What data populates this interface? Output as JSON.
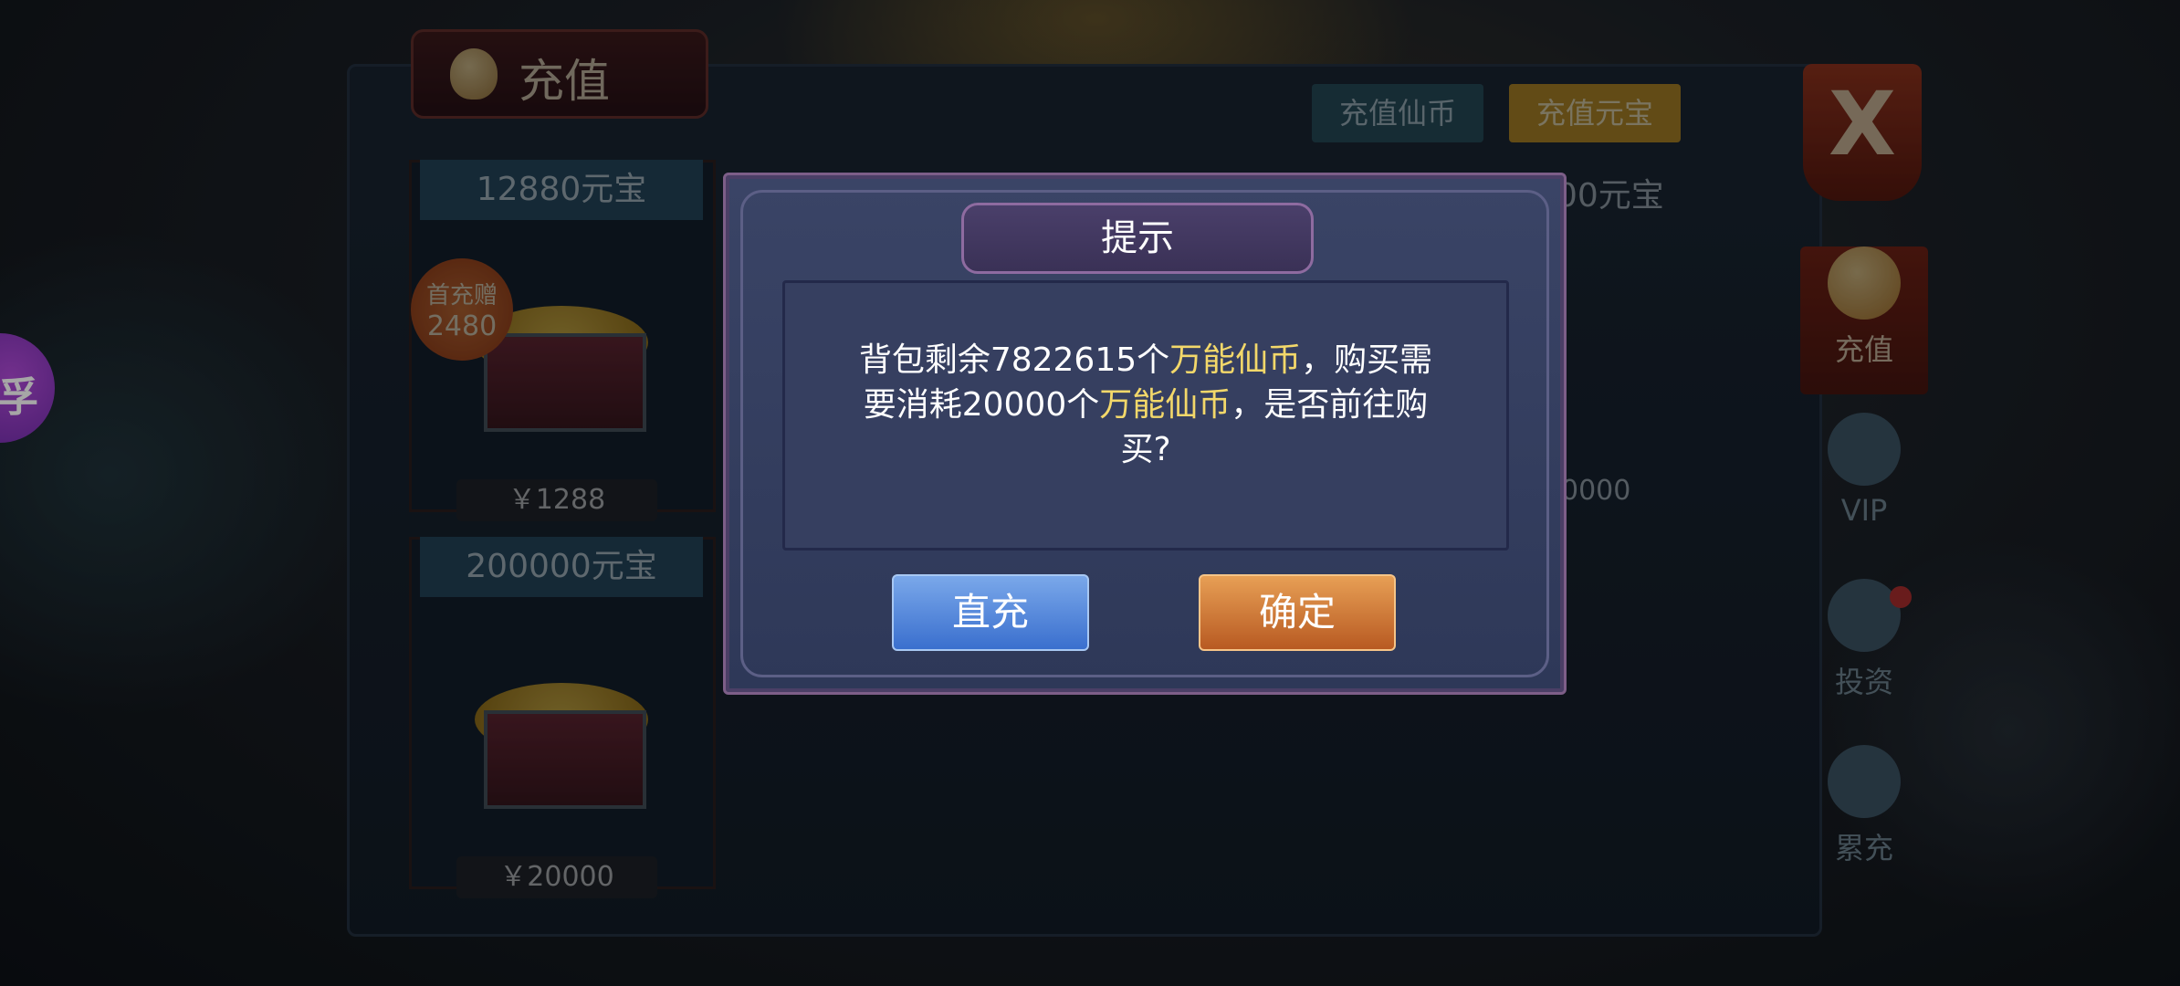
{
  "recharge_window": {
    "title": "充值",
    "tabs": [
      {
        "label": "充值仙币"
      },
      {
        "label": "充值元宝"
      }
    ],
    "close_label": "X",
    "items": [
      {
        "name": "12880元宝",
        "price": "￥1288",
        "badge_line1": "首充赠",
        "badge_amount": "2480"
      },
      {
        "name": "200000元宝",
        "price": "￥20000"
      }
    ],
    "partial_item_name": "00元宝",
    "partial_item_price": "0000",
    "side_nav": [
      {
        "label": "充值"
      },
      {
        "label": "VIP"
      },
      {
        "label": "投资"
      },
      {
        "label": "累充"
      }
    ]
  },
  "side_bubble": {
    "glyph": "孚"
  },
  "dialog": {
    "title": "提示",
    "message": {
      "part1": "背包剩余7822615个",
      "highlight1": "万能仙币",
      "part2": "，购买需要消耗20000个",
      "highlight2": "万能仙币",
      "part3": "，是否前往购买?"
    },
    "buttons": {
      "left": "直充",
      "right": "确定"
    }
  },
  "colors": {
    "highlight": "#f3d86a",
    "blue_button": "#3a6fce",
    "orange_button": "#b85a22"
  }
}
